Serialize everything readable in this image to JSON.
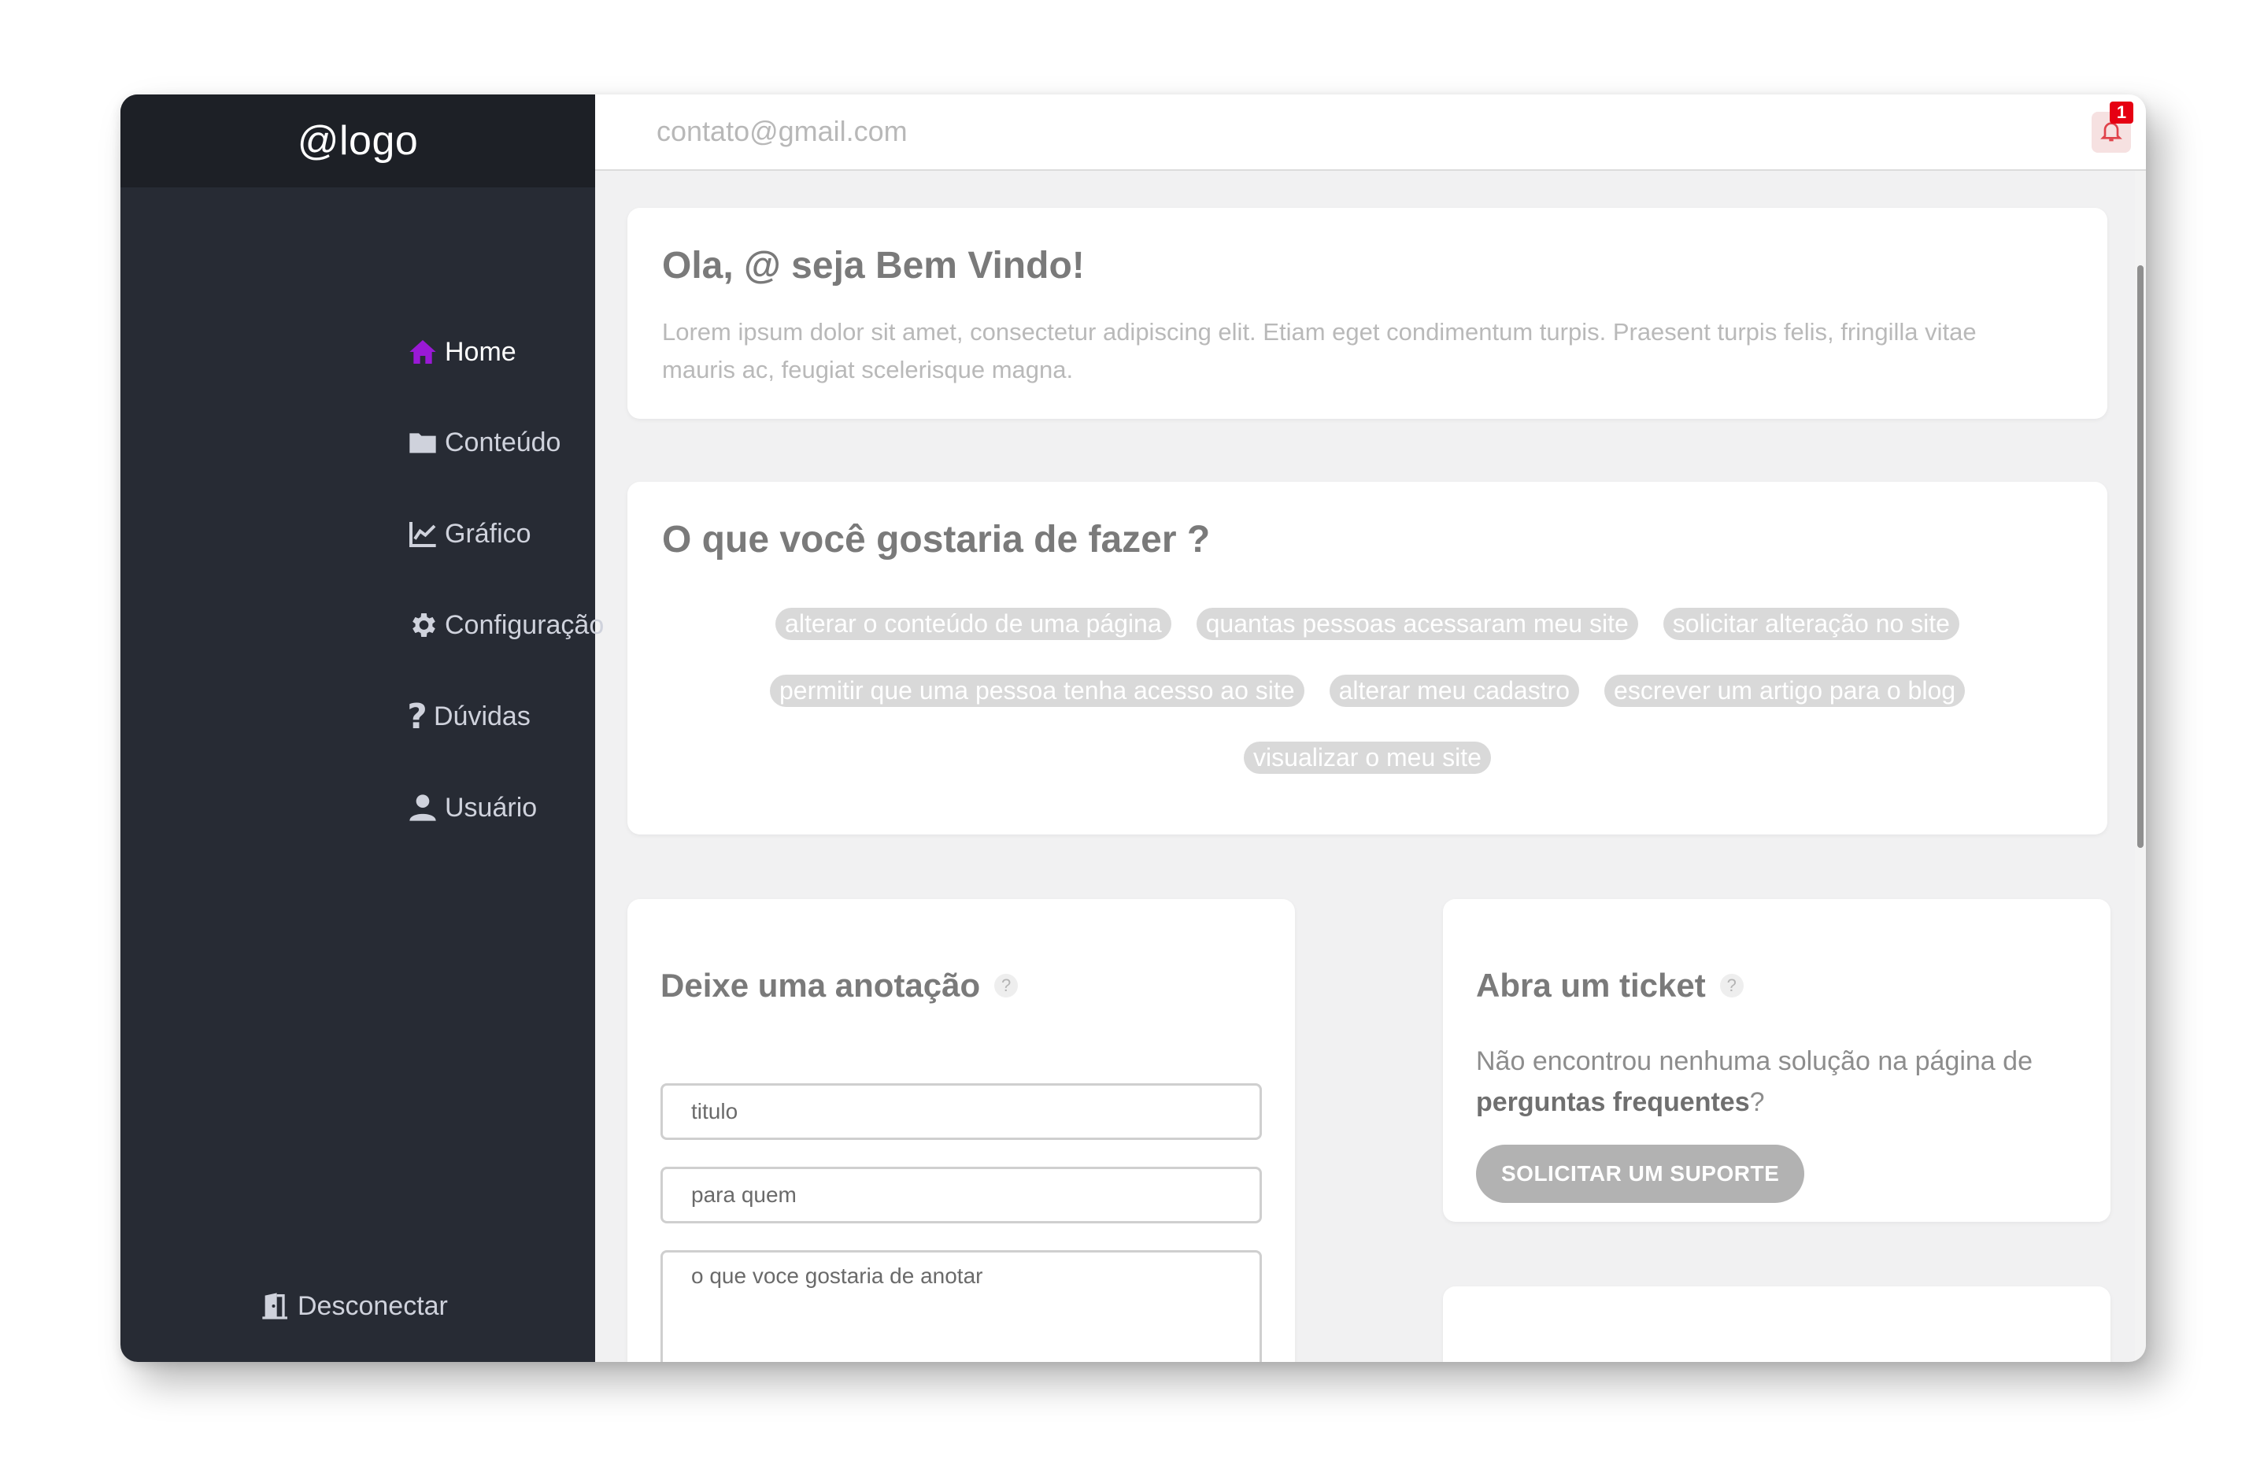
{
  "logo": "@logo",
  "colors": {
    "sidebar_bg": "#272b34",
    "logo_bg": "#1d2026",
    "active_icon": "#9a19d6",
    "icon": "#cfd2dc",
    "badge": "#e60012"
  },
  "sidebar": {
    "items": [
      {
        "label": "Home",
        "icon": "home-icon",
        "active": true
      },
      {
        "label": "Conteúdo",
        "icon": "folder-icon"
      },
      {
        "label": "Gráfico",
        "icon": "chart-line-icon"
      },
      {
        "label": "Configuração",
        "icon": "gear-icon"
      },
      {
        "label": "Dúvidas",
        "icon": "question-icon"
      },
      {
        "label": "Usuário",
        "icon": "user-icon"
      }
    ],
    "logout": {
      "label": "Desconectar",
      "icon": "door-exit-icon"
    }
  },
  "topbar": {
    "email": "contato@gmail.com",
    "notifications_count": "1",
    "bell_icon": "bell-icon",
    "search_icon": "search-icon"
  },
  "welcome": {
    "title": "Ola, @ seja Bem Vindo!",
    "text": "Lorem ipsum dolor sit amet, consectetur adipiscing elit. Etiam eget condimentum turpis. Praesent turpis felis, fringilla vitae mauris ac, feugiat scelerisque magna."
  },
  "actions": {
    "title": "O que você gostaria de fazer ?",
    "chips": [
      "alterar o conteúdo de uma página",
      "quantas pessoas acessaram meu site",
      "solicitar alteração no site",
      "permitir que uma pessoa tenha acesso ao site",
      "alterar meu cadastro",
      "escrever um artigo para o blog",
      "visualizar o meu site"
    ]
  },
  "note": {
    "title": "Deixe uma anotação",
    "help": "?",
    "title_placeholder": "titulo",
    "to_placeholder": "para quem",
    "body_placeholder": "o que voce gostaria de anotar"
  },
  "ticket": {
    "title": "Abra um ticket",
    "help": "?",
    "text_before": "Não encontrou nenhuma solução na página de ",
    "text_bold": "perguntas frequentes",
    "text_after": "?",
    "button": "SOLICITAR UM SUPORTE"
  }
}
